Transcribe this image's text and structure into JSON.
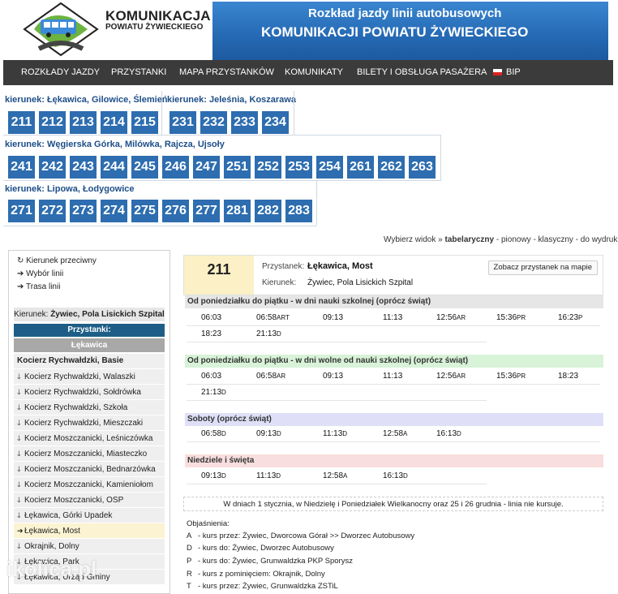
{
  "header": {
    "brand_line1": "KOMUNIKACJA",
    "brand_line2": "POWIATU ŻYWIECKIEGO",
    "banner_line1": "Rozkład jazdy linii autobusowych",
    "banner_line2": "KOMUNIKACJI POWIATU ŻYWIECKIEGO"
  },
  "nav": {
    "items": [
      "ROZKŁADY JAZDY",
      "PRZYSTANKI",
      "MAPA PRZYSTANKÓW",
      "KOMUNIKATY",
      "BILETY I OBSŁUGA PASAŻERA",
      "BIP"
    ]
  },
  "line_groups": [
    {
      "title": "kierunek: Łękawica, Gilowice, Ślemień",
      "lines": [
        "211",
        "212",
        "213",
        "214",
        "215"
      ]
    },
    {
      "title": "kierunek: Jeleśnia, Koszarawa",
      "lines": [
        "231",
        "232",
        "233",
        "234"
      ]
    },
    {
      "title": "kierunek: Węgierska Górka, Milówka, Rajcza, Ujsoły",
      "lines": [
        "241",
        "242",
        "243",
        "244",
        "245",
        "246",
        "247",
        "251",
        "252",
        "253",
        "254",
        "261",
        "262",
        "263"
      ]
    },
    {
      "title": "kierunek: Lipowa, Łodygowice",
      "lines": [
        "271",
        "272",
        "273",
        "274",
        "275",
        "276",
        "277",
        "281",
        "282",
        "283"
      ]
    }
  ],
  "view_switch": {
    "prefix": "Wybierz widok » ",
    "active": "tabelaryczny",
    "rest": " - pionowy - klasyczny - do wydruku »"
  },
  "sidebar": {
    "links": [
      "Kierunek przeciwny",
      "Wybór linii",
      "Trasa linii"
    ],
    "direction_label": "Kierunek:",
    "direction_value": "Żywiec, Pola Lisickich Szpital",
    "stops_header": "Przystanki:",
    "group_header": "Łękawica",
    "stops": [
      "Kocierz Rychwałdzki, Basie",
      "Kocierz Rychwałdzki, Walaszki",
      "Kocierz Rychwałdzki, Sołdrówka",
      "Kocierz Rychwałdzki, Szkoła",
      "Kocierz Rychwałdzki, Mieszczaki",
      "Kocierz Moszczanicki, Leśniczówka",
      "Kocierz Moszczanicki, Miasteczko",
      "Kocierz Moszczanicki, Bednarzówka",
      "Kocierz Moszczanicki, Kamieniołom",
      "Kocierz Moszczanicki, OSP",
      "Łękawica, Górki Upadek",
      "Łękawica, Most",
      "Okrajnik, Dolny",
      "Łękawica, Park",
      "Łękawica, Urząd Gminy"
    ]
  },
  "stop_info": {
    "line": "211",
    "stop_label": "Przystanek:",
    "stop_name": "Łękawica, Most",
    "direction_label": "Kierunek:",
    "direction_value": "Żywiec, Pola Lisickich Szpital",
    "map_button": "Zobacz przystanek na mapie"
  },
  "timetable": [
    {
      "title": "Od poniedziałku do piątku - w dni nauki szkolnej (oprócz świąt)",
      "rows": [
        [
          [
            "06:03",
            ""
          ],
          [
            "06:58",
            "ART"
          ],
          [
            "09:13",
            ""
          ],
          [
            "11:13",
            ""
          ],
          [
            "12:56",
            "AR"
          ],
          [
            "15:36",
            "PR"
          ],
          [
            "16:23",
            "P"
          ]
        ],
        [
          [
            "18:23",
            ""
          ],
          [
            "21:13",
            "D"
          ]
        ]
      ]
    },
    {
      "title": "Od poniedziałku do piątku - w dni wolne od nauki szkolnej (oprócz świąt)",
      "rows": [
        [
          [
            "06:03",
            ""
          ],
          [
            "06:58",
            "AR"
          ],
          [
            "09:13",
            ""
          ],
          [
            "11:13",
            ""
          ],
          [
            "12:56",
            "AR"
          ],
          [
            "15:36",
            "PR"
          ],
          [
            "18:23",
            ""
          ]
        ],
        [
          [
            "21:13",
            "D"
          ]
        ]
      ]
    },
    {
      "title": "Soboty (oprócz świąt)",
      "rows": [
        [
          [
            "06:58",
            "D"
          ],
          [
            "09:13",
            "D"
          ],
          [
            "11:13",
            "D"
          ],
          [
            "12:58",
            "A"
          ],
          [
            "16:13",
            "D"
          ]
        ]
      ]
    },
    {
      "title": "Niedziele i święta",
      "rows": [
        [
          [
            "09:13",
            "D"
          ],
          [
            "11:13",
            "D"
          ],
          [
            "12:58",
            "A"
          ],
          [
            "16:13",
            "D"
          ]
        ]
      ]
    }
  ],
  "notice": "W dniach 1 stycznia, w Niedzielę i Poniedziałek Wielkanocny oraz 25 i 26 grudnia - linia nie kursuje.",
  "explanations": {
    "title": "Objaśnienia:",
    "items": [
      {
        "code": "A",
        "text": "- kurs przez: Żywiec, Dworcowa Górał >> Dworzec Autobusowy"
      },
      {
        "code": "D",
        "text": "- kurs do: Żywiec, Dworzec Autobusowy"
      },
      {
        "code": "P",
        "text": "- kurs do: Żywiec, Grunwaldzka PKP Sporysz"
      },
      {
        "code": "R",
        "text": "- kurs z pominięciem: Okrajnik, Dolny"
      },
      {
        "code": "T",
        "text": "- kurs przez: Żywiec, Grunwaldzka ZSTiL"
      }
    ]
  },
  "watermark": "ikolica.pl",
  "colors": {
    "nav_bg": "#3b3b3b",
    "line_button": "#2d6db0",
    "banner": "#2569b4"
  }
}
